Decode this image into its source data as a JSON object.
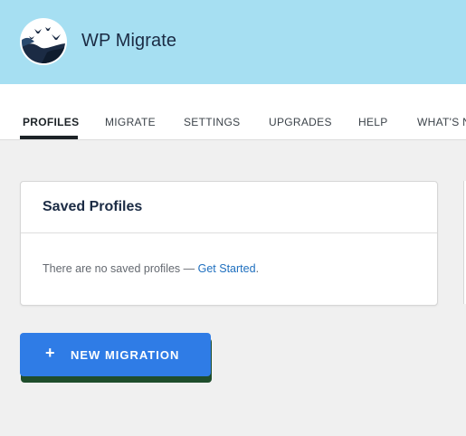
{
  "app": {
    "title": "WP Migrate",
    "logo_icon": "wp-migrate-birds-logo"
  },
  "tabs": [
    {
      "label": "PROFILES",
      "active": true
    },
    {
      "label": "MIGRATE",
      "active": false
    },
    {
      "label": "SETTINGS",
      "active": false
    },
    {
      "label": "UPGRADES",
      "active": false
    },
    {
      "label": "HELP",
      "active": false
    },
    {
      "label": "WHAT'S NEW",
      "active": false
    }
  ],
  "saved_profiles": {
    "title": "Saved Profiles",
    "empty_text": "There are no saved profiles — ",
    "link_label": "Get Started",
    "trailing": "."
  },
  "actions": {
    "new_migration_icon": "+",
    "new_migration_label": "NEW MIGRATION"
  },
  "colors": {
    "header_bg": "#a6dff2",
    "primary": "#2f7ce6",
    "link": "#1e6fbf",
    "button_shadow": "#1f4d2c"
  }
}
